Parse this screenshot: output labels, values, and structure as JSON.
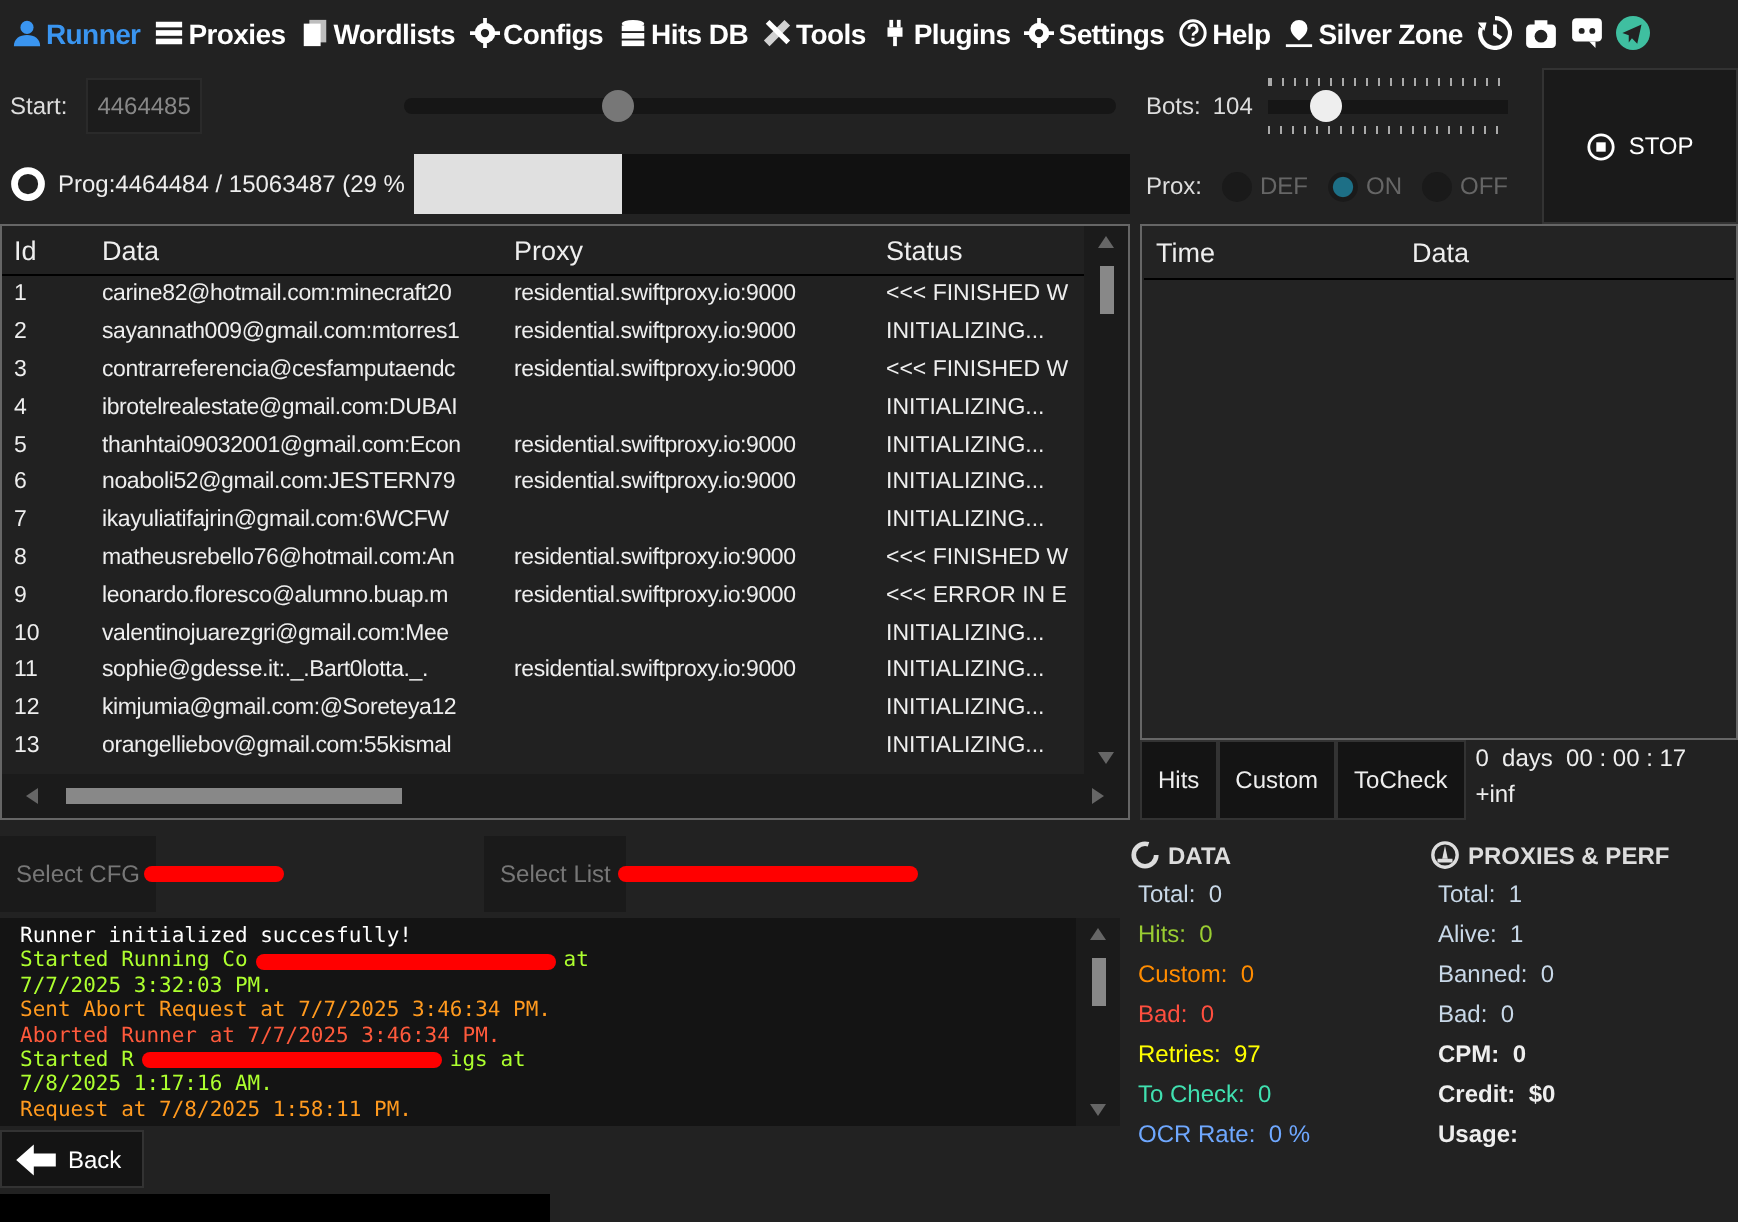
{
  "nav": [
    {
      "label": "Runner",
      "selected": true
    },
    {
      "label": "Proxies",
      "selected": false
    },
    {
      "label": "Wordlists",
      "selected": false
    },
    {
      "label": "Configs",
      "selected": false
    },
    {
      "label": "Hits DB",
      "selected": false
    },
    {
      "label": "Tools",
      "selected": false
    },
    {
      "label": "Plugins",
      "selected": false
    },
    {
      "label": "Settings",
      "selected": false
    },
    {
      "label": "Help",
      "selected": false
    },
    {
      "label": "Silver Zone",
      "selected": false
    }
  ],
  "start": {
    "label": "Start:",
    "value": "4464485",
    "level": 0.3
  },
  "bots": {
    "label": "Bots:",
    "value": "104",
    "level": 0.24
  },
  "progress": {
    "label": "Prog:",
    "text": "4464484 / 15063487 (29 %",
    "level": 0.29
  },
  "proxy_mode": {
    "label": "Prox:",
    "options": [
      {
        "label": "DEF",
        "selected": false
      },
      {
        "label": "ON",
        "selected": true
      },
      {
        "label": "OFF",
        "selected": false
      }
    ]
  },
  "stop_button": "STOP",
  "table": {
    "columns": [
      "Id",
      "Data",
      "Proxy",
      "Status"
    ],
    "rows": [
      [
        "1",
        "carine82@hotmail.com:minecraft20",
        "residential.swiftproxy.io:9000",
        "<<< FINISHED W"
      ],
      [
        "2",
        "sayannath009@gmail.com:mtorres1",
        "residential.swiftproxy.io:9000",
        "INITIALIZING..."
      ],
      [
        "3",
        "contrarreferencia@cesfamputaendc",
        "residential.swiftproxy.io:9000",
        "<<< FINISHED W"
      ],
      [
        "4",
        "ibrotelrealestate@gmail.com:DUBAI",
        "",
        "INITIALIZING..."
      ],
      [
        "5",
        "thanhtai09032001@gmail.com:Econ",
        "residential.swiftproxy.io:9000",
        "INITIALIZING..."
      ],
      [
        "6",
        "noaboli52@gmail.com:JESTERN79",
        "residential.swiftproxy.io:9000",
        "INITIALIZING..."
      ],
      [
        "7",
        "ikayuliatifajrin@gmail.com:6WCFW",
        "",
        "INITIALIZING..."
      ],
      [
        "8",
        "matheusrebello76@hotmail.com:An",
        "residential.swiftproxy.io:9000",
        "<<< FINISHED W"
      ],
      [
        "9",
        "leonardo.floresco@alumno.buap.m",
        "residential.swiftproxy.io:9000",
        "<<< ERROR IN E"
      ],
      [
        "10",
        "valentinojuarezgri@gmail.com:Mee",
        "",
        "INITIALIZING..."
      ],
      [
        "11",
        "sophie@gdesse.it:._.Bart0lotta._.",
        "residential.swiftproxy.io:9000",
        "INITIALIZING..."
      ],
      [
        "12",
        "kimjumia@gmail.com:@Soreteya12",
        "",
        "INITIALIZING..."
      ],
      [
        "13",
        "orangelliebov@gmail.com:55kismal",
        "",
        "INITIALIZING..."
      ]
    ]
  },
  "hits_table": {
    "columns": [
      "Time",
      "Data"
    ]
  },
  "hit_tabs": [
    "Hits",
    "Custom",
    "ToCheck"
  ],
  "elapsed": "0  days  00 : 00 : 17",
  "eta": "+inf",
  "select_config": {
    "label": "Select CFG"
  },
  "select_list": {
    "label": "Select List"
  },
  "log": [
    {
      "kind": "info",
      "parts": [
        "Runner initialized succesfully!"
      ]
    },
    {
      "kind": "success",
      "parts": [
        "Started Running Co",
        "at"
      ]
    },
    {
      "kind": "success",
      "parts": [
        "7/7/2025 3:32:03 PM."
      ]
    },
    {
      "kind": "warning",
      "parts": [
        "Sent Abort Request at 7/7/2025 3:46:34 PM."
      ]
    },
    {
      "kind": "error",
      "parts": [
        "Aborted Runner at 7/7/2025 3:46:34 PM."
      ]
    },
    {
      "kind": "success",
      "parts": [
        "Started R",
        "igs at"
      ]
    },
    {
      "kind": "success",
      "parts": [
        "7/8/2025 1:17:16 AM."
      ]
    },
    {
      "kind": "warning",
      "parts": [
        "Request at 7/8/2025 1:58:11 PM."
      ]
    }
  ],
  "back_button": "Back",
  "data_stats": {
    "title": "DATA",
    "items": [
      {
        "label": "Total:",
        "value": "0",
        "color": "#c8d8e8"
      },
      {
        "label": "Hits:",
        "value": "0",
        "color": "#9acd32"
      },
      {
        "label": "Custom:",
        "value": "0",
        "color": "#ff8c00"
      },
      {
        "label": "Bad:",
        "value": "0",
        "color": "#ff4f3f"
      },
      {
        "label": "Retries:",
        "value": "97",
        "color": "#ffff00"
      },
      {
        "label": "To Check:",
        "value": "0",
        "color": "#40e0b0"
      },
      {
        "label": "OCR Rate:",
        "value": "0 %",
        "color": "#6fa8ff"
      }
    ]
  },
  "proxy_stats": {
    "title": "PROXIES & PERF",
    "items": [
      {
        "label": "Total:",
        "value": "1",
        "kind": "normal"
      },
      {
        "label": "Alive:",
        "value": "1",
        "kind": "normal"
      },
      {
        "label": "Banned:",
        "value": "0",
        "kind": "normal"
      },
      {
        "label": "Bad:",
        "value": "0",
        "kind": "normal"
      },
      {
        "label": "CPM:",
        "value": "0",
        "kind": "strong"
      },
      {
        "label": "Credit:",
        "value": "$0",
        "kind": "strong"
      },
      {
        "label": "Usage:",
        "kind": "strong"
      }
    ]
  }
}
